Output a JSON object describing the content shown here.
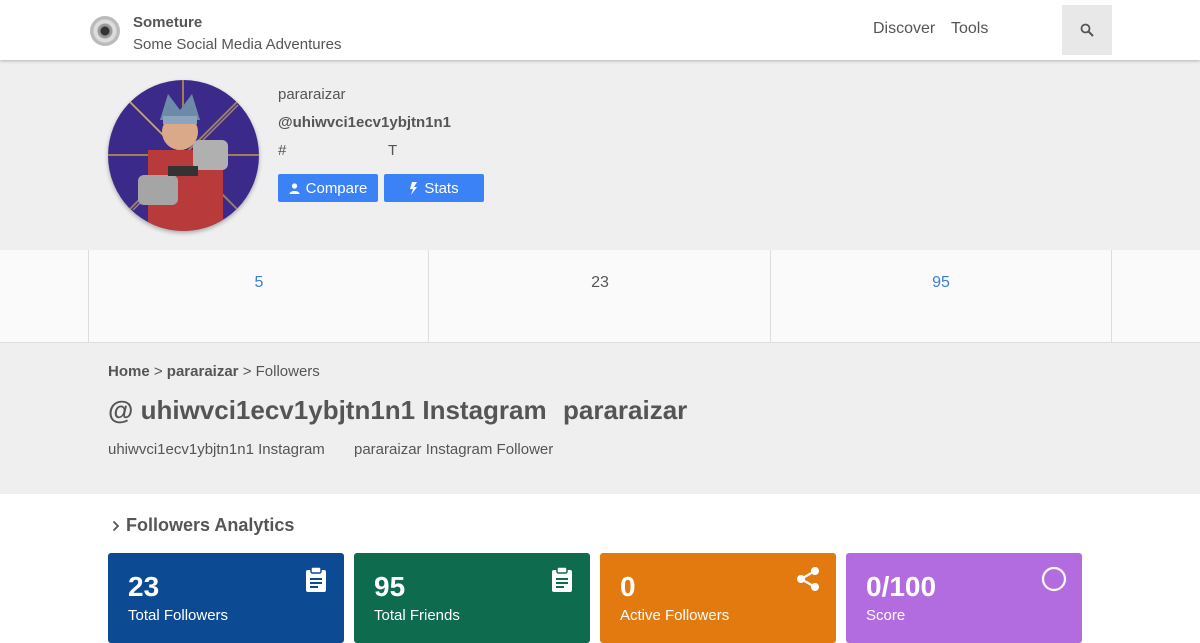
{
  "nav": {
    "brand_name": "Someture",
    "brand_tagline": "Some Social Media Adventures",
    "links": [
      "Discover",
      "Tools"
    ],
    "search_icon": "search-icon"
  },
  "profile": {
    "name": "pararaizar",
    "handle": "@uhiwvci1ecv1ybjtn1n1",
    "hash": "#",
    "t": "T",
    "compare_label": "Compare",
    "stats_label": "Stats"
  },
  "counts": {
    "posts": "5",
    "followers": "23",
    "following": "95",
    "colors": {
      "link": "#3b7dd8",
      "plain": "#555555"
    }
  },
  "title": {
    "breadcrumb_home": "Home",
    "breadcrumb_sep1": ">",
    "breadcrumb_user": "pararaizar",
    "breadcrumb_sep2": ">",
    "breadcrumb_current": "Followers",
    "heading_main": "@ uhiwvci1ecv1ybjtn1n1 Instagram",
    "heading_name": "pararaizar",
    "sub_main": "uhiwvci1ecv1ybjtn1n1 Instagram",
    "sub_name": "pararaizar Instagram Follower"
  },
  "analytics": {
    "title": "Followers Analytics",
    "cards": [
      {
        "value": "23",
        "label": "Total Followers",
        "color": "#0d4a94",
        "icon": "clipboard-icon"
      },
      {
        "value": "95",
        "label": "Total Friends",
        "color": "#0e6b4d",
        "icon": "clipboard-icon"
      },
      {
        "value": "0",
        "label": "Active Followers",
        "color": "#e37a0f",
        "icon": "share-icon"
      },
      {
        "value": "0/100",
        "label": "Score",
        "color": "#b36ce0",
        "icon": "circle-icon"
      }
    ]
  }
}
